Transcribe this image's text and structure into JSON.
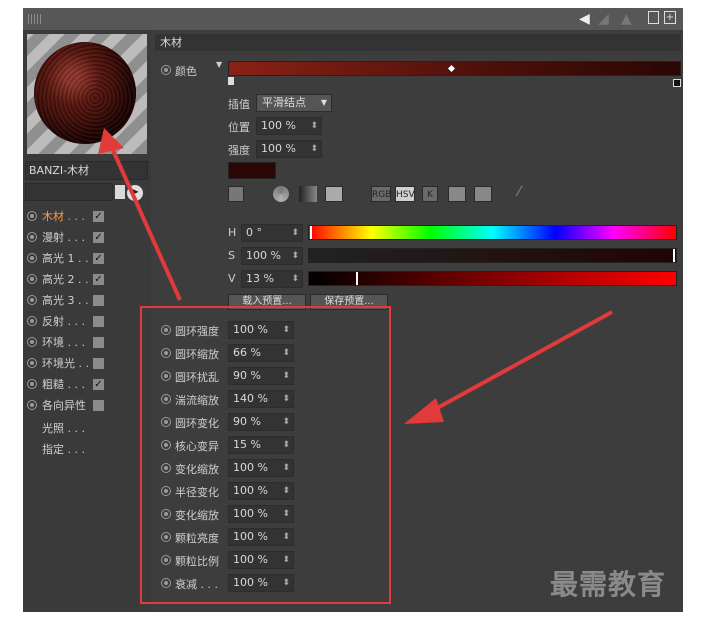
{
  "left_panel": {
    "material_name": "BANZI-木材",
    "channels": [
      {
        "label": "木材 . . .",
        "checked": true,
        "active": true
      },
      {
        "label": "漫射 . . .",
        "checked": true
      },
      {
        "label": "高光 1 . .",
        "checked": true
      },
      {
        "label": "高光 2 . .",
        "checked": true
      },
      {
        "label": "高光 3 . .",
        "checked": false
      },
      {
        "label": "反射 . . .",
        "checked": false
      },
      {
        "label": "环境 . . .",
        "checked": false
      },
      {
        "label": "环境光 . .",
        "checked": false
      },
      {
        "label": "粗糙 . . .",
        "checked": true
      },
      {
        "label": "各向异性",
        "checked": false
      }
    ],
    "extra_items": [
      "光照 . . .",
      "指定 . . ."
    ]
  },
  "right_panel": {
    "section_title": "木材",
    "color_label": "颜色",
    "interp_label": "插值",
    "interp_value": "平滑结点",
    "position_label": "位置",
    "position_value": "100 %",
    "strength_label": "强度",
    "strength_value": "100 %",
    "modes": [
      "RGB",
      "HSV",
      "K"
    ],
    "h_label": "H",
    "h_value": "0 °",
    "s_label": "S",
    "s_value": "100 %",
    "v_label": "V",
    "v_value": "13 %",
    "load_preset": "载入预置...",
    "save_preset": "保存预置...",
    "params": [
      {
        "label": "圆环强度",
        "value": "100 %"
      },
      {
        "label": "圆环缩放",
        "value": "66 %"
      },
      {
        "label": "圆环扰乱",
        "value": "90 %"
      },
      {
        "label": "湍流缩放",
        "value": "140 %"
      },
      {
        "label": "圆环变化",
        "value": "90 %"
      },
      {
        "label": "核心变异",
        "value": "15 %"
      },
      {
        "label": "变化缩放",
        "value": "100 %"
      },
      {
        "label": "半径变化",
        "value": "100 %"
      },
      {
        "label": "变化缩放",
        "value": "100 %"
      },
      {
        "label": "颗粒亮度",
        "value": "100 %"
      },
      {
        "label": "颗粒比例",
        "value": "100 %"
      },
      {
        "label": "衰减 . . .",
        "value": "100 %"
      }
    ]
  },
  "watermark": "最需教育",
  "colors": {
    "highlight": "#e23a3a",
    "active_channel": "#ff9a3c"
  },
  "icons": [
    "grip-icon",
    "back-arrow-icon",
    "lock-icon",
    "expand-icon",
    "cursor-icon",
    "eyedropper-icon"
  ]
}
